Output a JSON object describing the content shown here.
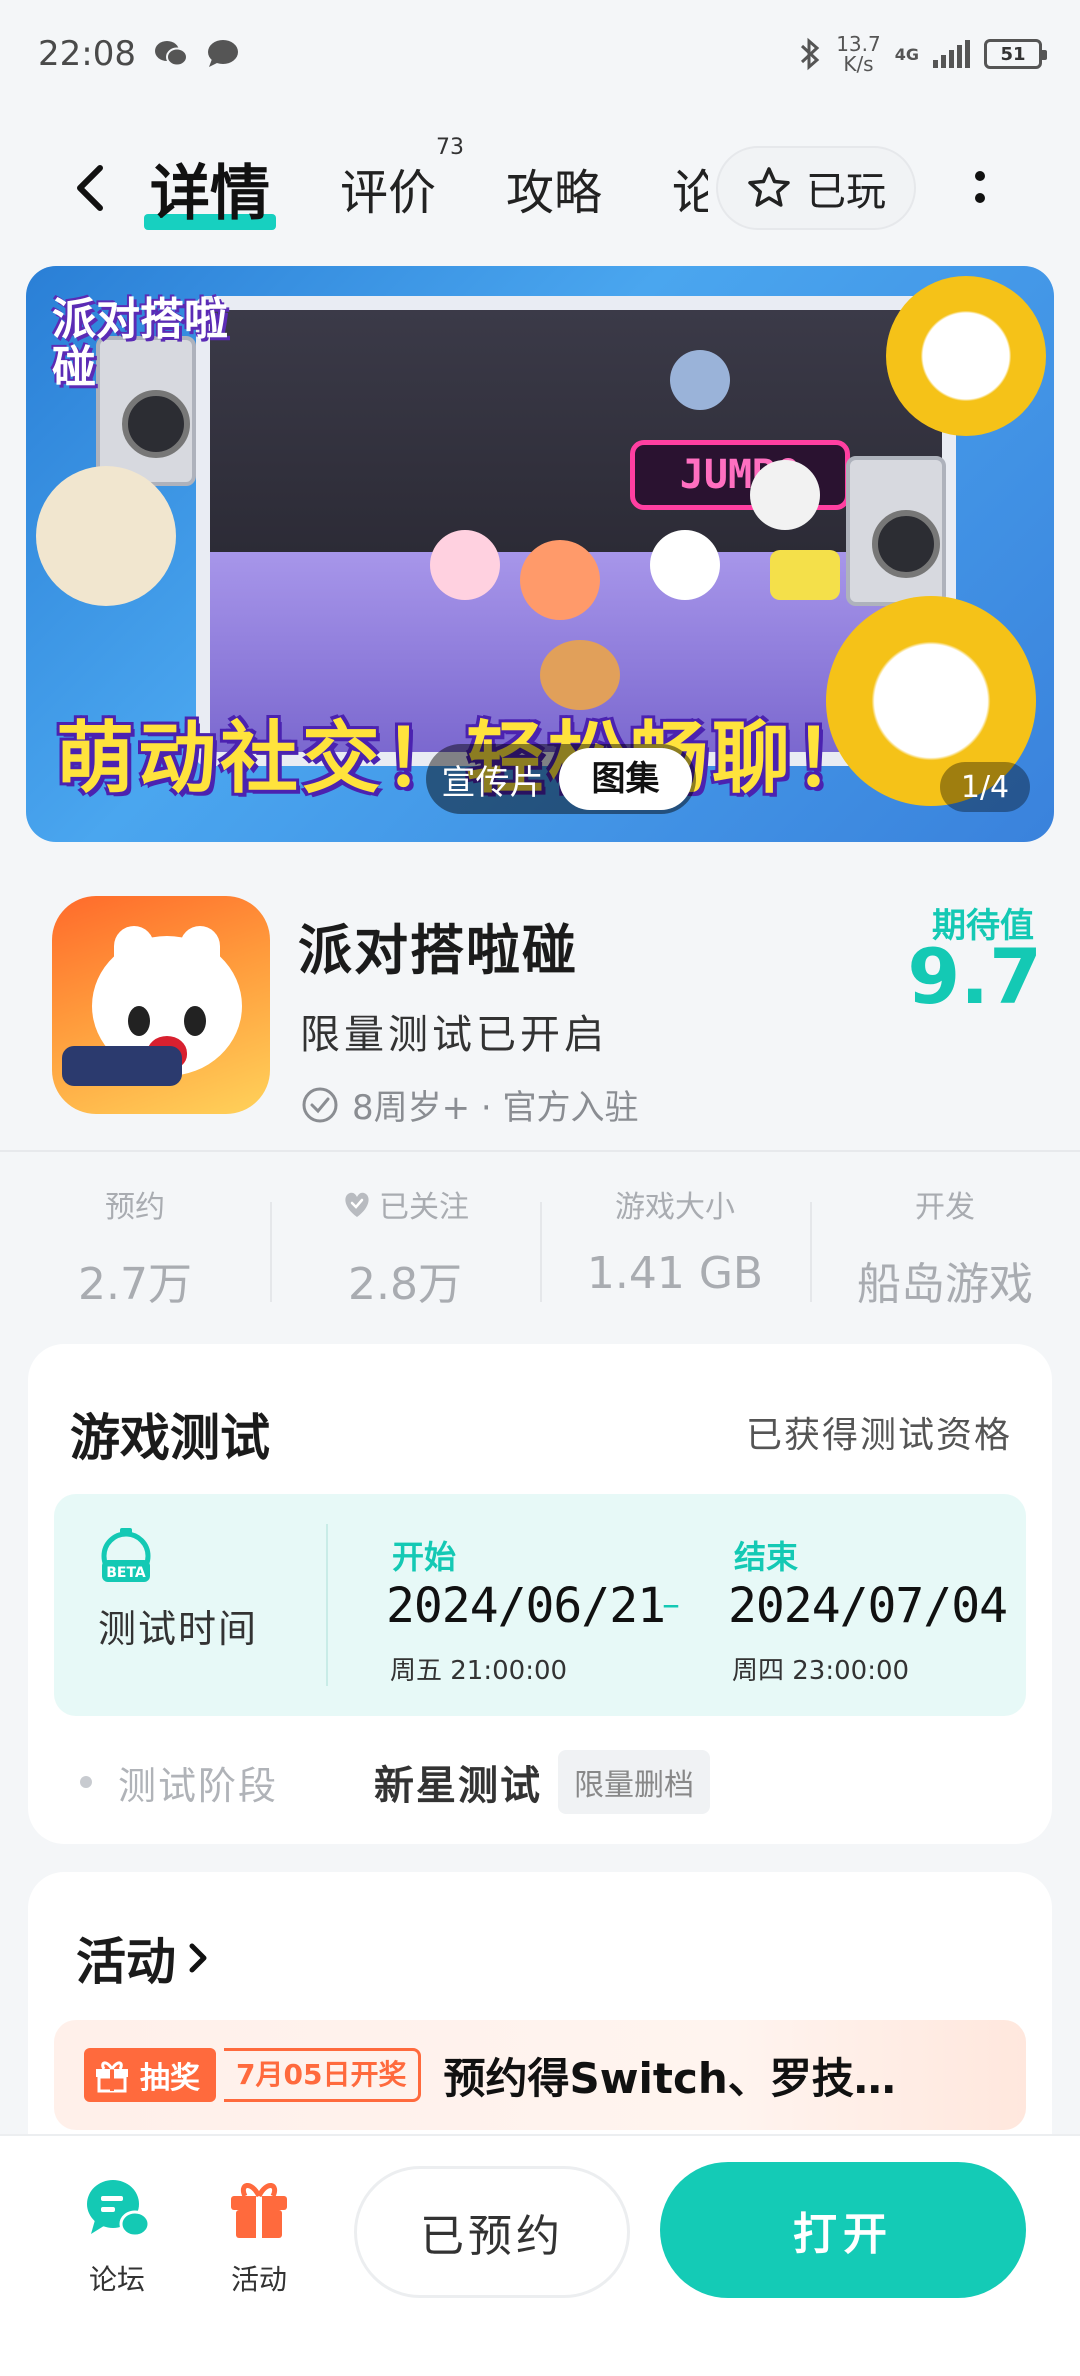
{
  "status_bar": {
    "time": "22:08",
    "net_speed_value": "13.7",
    "net_speed_unit": "K/s",
    "network_type": "4G",
    "battery": "51",
    "icons": [
      "wechat-icon",
      "message-icon",
      "bluetooth-icon",
      "signal-icon",
      "battery-icon"
    ]
  },
  "nav": {
    "tabs": [
      {
        "label": "详情",
        "active": true
      },
      {
        "label": "评价",
        "badge": "73"
      },
      {
        "label": "攻略"
      },
      {
        "label": "论"
      }
    ],
    "played_label": "已玩"
  },
  "banner": {
    "logo_text": "派对搭啦碰",
    "slogan": "萌动社交！轻松畅聊！",
    "neon_sign": "JUMBO",
    "toggle": [
      "宣传片",
      "图集"
    ],
    "page_indicator": "1/4"
  },
  "game": {
    "title": "派对搭啦碰",
    "subtitle": "限量测试已开启",
    "meta": "8周岁+ · 官方入驻",
    "expect_label": "期待值",
    "expect_value": "9.7"
  },
  "stats": [
    {
      "label": "预约",
      "value": "2.7万"
    },
    {
      "label": "已关注",
      "value": "2.8万"
    },
    {
      "label": "游戏大小",
      "value": "1.41 GB"
    },
    {
      "label": "开发",
      "value": "船岛游戏"
    }
  ],
  "test": {
    "title": "游戏测试",
    "qualification": "已获得测试资格",
    "time_label": "测试时间",
    "beta_badge": "BETA",
    "start_label": "开始",
    "start_date": "2024/06/21",
    "start_time": "周五 21:00:00",
    "end_label": "结束",
    "end_date": "2024/07/04",
    "end_time": "周四 23:00:00",
    "stage_label": "测试阶段",
    "stage_value": "新星测试",
    "stage_tag": "限量删档"
  },
  "activity": {
    "title": "活动",
    "badge": "抽奖",
    "draw_date": "7月05日开奖",
    "text": "预约得Switch、罗技…"
  },
  "bottom_bar": {
    "forum_label": "论坛",
    "event_label": "活动",
    "reserved_label": "已预约",
    "open_label": "打开"
  },
  "colors": {
    "accent": "#14cbb6",
    "orange": "#ff6a3d",
    "background": "#f4f6f8"
  }
}
